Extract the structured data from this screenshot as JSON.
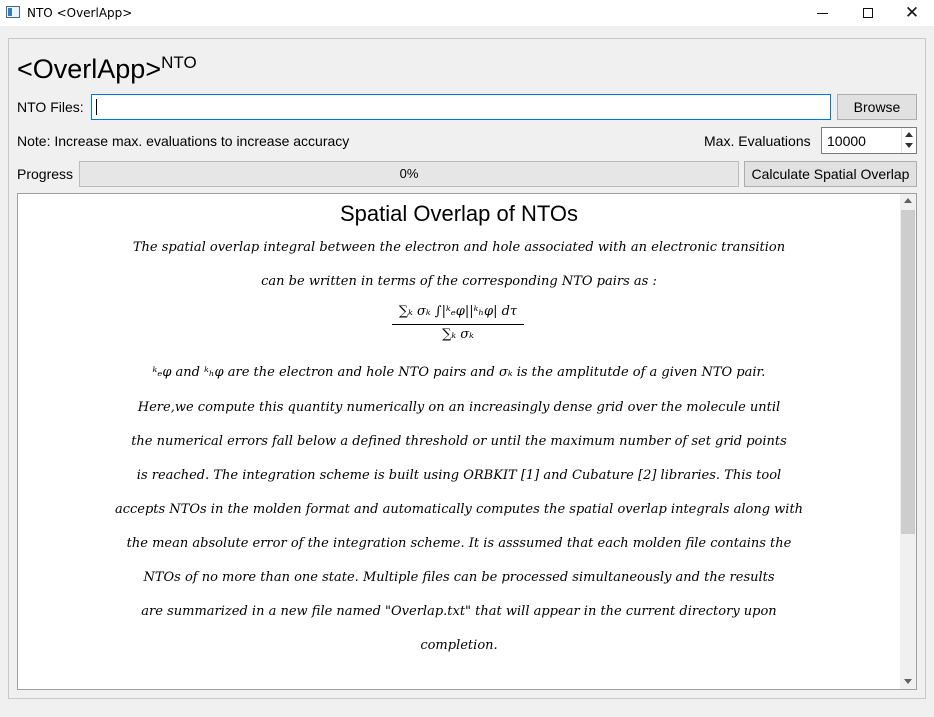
{
  "window": {
    "title": "NTO <OverlApp>",
    "minimize_glyph": "",
    "maximize_glyph": "",
    "close_glyph": "✕"
  },
  "app": {
    "heading": "<OverlApp>",
    "heading_sup": "NTO"
  },
  "files": {
    "label": "NTO Files:",
    "value": "",
    "browse_label": "Browse"
  },
  "note": {
    "text": "Note: Increase max. evaluations to increase accuracy"
  },
  "max_eval": {
    "label": "Max. Evaluations",
    "value": "10000"
  },
  "progress": {
    "label": "Progress",
    "percent": 0,
    "text": "0%",
    "fill_color": "#06b025"
  },
  "calculate": {
    "label": "Calculate Spatial Overlap"
  },
  "description": {
    "title": "Spatial Overlap of NTOs",
    "lines": [
      "The spatial overlap integral between the electron and hole associated with an electronic transition",
      "can be written in terms of the corresponding NTO pairs as :",
      "ᵏₑφ and ᵏₕφ are the electron and  hole NTO pairs and σₖ is the amplitutde of a given NTO pair.",
      "Here,we compute this quantity numerically on an increasingly dense grid over the molecule until",
      "the numerical errors fall below a defined threshold or until the maximum number of set grid points",
      "is reached. The integration scheme is built using ORBKIT [1] and Cubature [2] libraries.  This tool",
      "accepts NTOs in the molden format and automatically computes the spatial overlap integrals along with",
      "the mean absolute error of the integration scheme. It is asssumed that each molden file contains the",
      "NTOs of no more than one state.  Multiple files  can be processed simultaneously and the results",
      "are summarized in a new file named \"Overlap.txt\" that will appear in the current directory upon",
      "completion."
    ],
    "formula_numerator": "∑ₖ σₖ ∫|ᵏₑφ||ᵏₕφ| dτ",
    "formula_denominator": "∑ₖ σₖ"
  }
}
